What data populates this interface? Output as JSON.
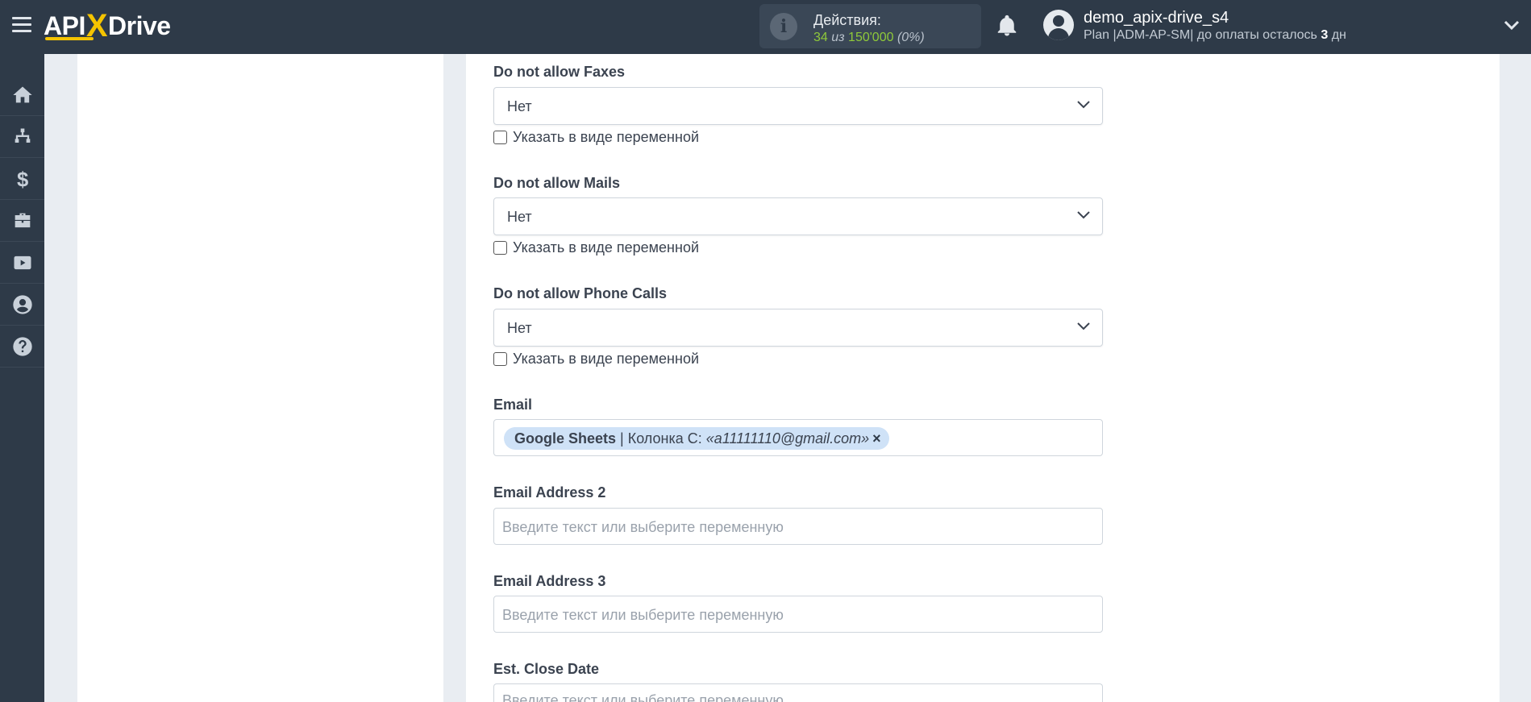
{
  "header": {
    "logo": {
      "api": "API",
      "x": "X",
      "drive": "Drive"
    },
    "actions": {
      "label": "Действия:",
      "used": "34",
      "of_word": "из",
      "total": "150'000",
      "percent": "(0%)"
    },
    "user": {
      "name": "demo_apix-drive_s4",
      "plan_prefix": "Plan |ADM-AP-SM| до оплаты осталось",
      "days": "3",
      "days_unit": "дн"
    }
  },
  "sidebar": {
    "items": [
      {
        "icon": "home-icon"
      },
      {
        "icon": "sitemap-icon"
      },
      {
        "icon": "dollar-icon"
      },
      {
        "icon": "briefcase-icon"
      },
      {
        "icon": "youtube-icon"
      },
      {
        "icon": "user-circle-icon"
      },
      {
        "icon": "question-icon"
      }
    ]
  },
  "form": {
    "variable_checkbox_label": "Указать в виде переменной",
    "fields": [
      {
        "label": "Do not allow Faxes",
        "value": "Нет"
      },
      {
        "label": "Do not allow Mails",
        "value": "Нет"
      },
      {
        "label": "Do not allow Phone Calls",
        "value": "Нет"
      },
      {
        "label": "Email",
        "tag": {
          "source": "Google Sheets",
          "column": "| Колонка С:",
          "value": "«a11111110@gmail.com»",
          "remove": "×"
        }
      },
      {
        "label": "Email Address 2",
        "placeholder": "Введите текст или выберите переменную"
      },
      {
        "label": "Email Address 3",
        "placeholder": "Введите текст или выберите переменную"
      },
      {
        "label": "Est. Close Date",
        "placeholder": "Введите текст или выберите переменную"
      }
    ]
  },
  "colors": {
    "topbar": "#2e3a48",
    "accent_yellow": "#f5c400",
    "counter_green": "#8fc93a",
    "tag_bg": "#cfe2f7"
  }
}
